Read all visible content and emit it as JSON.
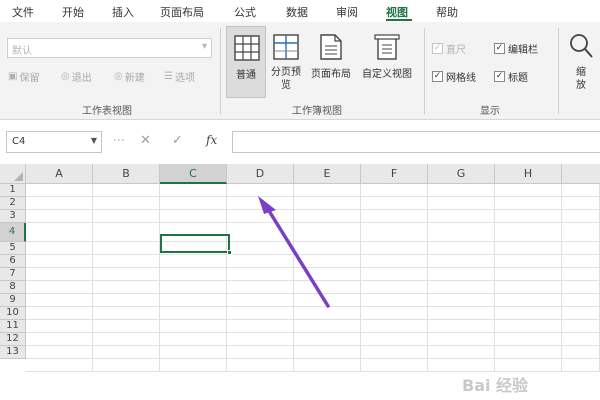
{
  "menu_tabs": [
    "文件",
    "开始",
    "插入",
    "页面布局",
    "公式",
    "数据",
    "审阅",
    "视图",
    "帮助"
  ],
  "active_tab": "视图",
  "ribbon": {
    "sheet_view": {
      "dropdown_value": "默认",
      "buttons": [
        "保留",
        "退出",
        "新建",
        "选项"
      ],
      "group_label": "工作表视图"
    },
    "workbook_views": {
      "buttons": [
        "普通",
        "分页预览",
        "页面布局",
        "自定义视图"
      ],
      "selected": "普通",
      "group_label": "工作簿视图"
    },
    "show": {
      "checkboxes": [
        {
          "label": "直尺",
          "checked": true,
          "enabled": false
        },
        {
          "label": "编辑栏",
          "checked": true,
          "enabled": true
        },
        {
          "label": "网格线",
          "checked": true,
          "enabled": true
        },
        {
          "label": "标题",
          "checked": true,
          "enabled": true
        }
      ],
      "group_label": "显示"
    },
    "zoom": {
      "label": "缩放"
    }
  },
  "formula_bar": {
    "name_box": "C4",
    "formula": "",
    "cancel_icon": "close-icon",
    "enter_icon": "check-icon",
    "function_label": "fx"
  },
  "grid": {
    "columns": [
      "A",
      "B",
      "C",
      "D",
      "E",
      "F",
      "G",
      "H"
    ],
    "rows": [
      "1",
      "2",
      "3",
      "4",
      "5",
      "6",
      "7",
      "8",
      "9",
      "10",
      "11",
      "12",
      "13"
    ],
    "selected_cell": "C4",
    "selected_column": "C",
    "selected_row": "4"
  },
  "annotation": {
    "color": "#7b3fc4"
  },
  "watermark": "Bai 经验",
  "colors": {
    "accent": "#217346",
    "ribbon_bg": "#f3f3f3"
  }
}
